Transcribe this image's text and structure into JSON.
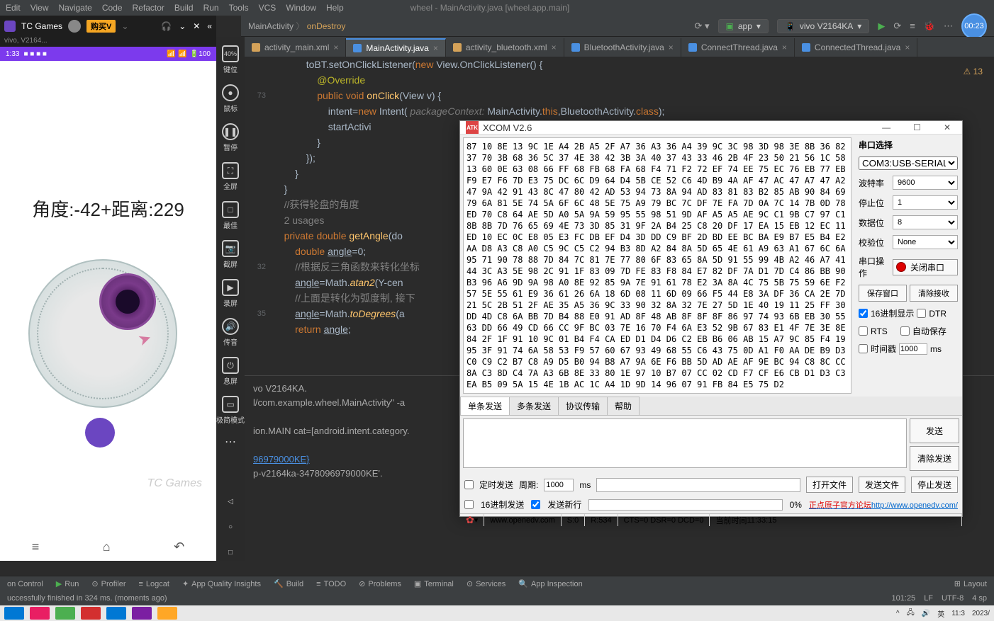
{
  "ide": {
    "menubar": [
      "Edit",
      "View",
      "Navigate",
      "Code",
      "Refactor",
      "Build",
      "Run",
      "Tools",
      "VCS",
      "Window",
      "Help"
    ],
    "title": "wheel - MainActivity.java [wheel.app.main]",
    "breadcrumb_class": "MainActivity",
    "breadcrumb_method": "onDestroy",
    "app_label": "app",
    "device_label": "vivo V2164KA",
    "timer": "00:23",
    "warnings": "13",
    "tabs": [
      {
        "name": "activity_main.xml",
        "type": "xml",
        "active": false
      },
      {
        "name": "MainActivity.java",
        "type": "java",
        "active": true
      },
      {
        "name": "activity_bluetooth.xml",
        "type": "xml",
        "active": false
      },
      {
        "name": "BluetoothActivity.java",
        "type": "java",
        "active": false
      },
      {
        "name": "ConnectThread.java",
        "type": "java",
        "active": false
      },
      {
        "name": "ConnectedThread.java",
        "type": "java",
        "active": false
      }
    ],
    "gutters": [
      "",
      "",
      "73",
      "",
      "",
      "",
      "",
      "",
      "",
      "",
      "",
      "",
      "",
      "",
      "32",
      "",
      "",
      "",
      "35",
      "",
      "",
      "",
      ""
    ],
    "usages": "2 usages",
    "code_text": {
      "l1a": "toBT",
      "l1b": ".setOnClickListener(",
      "l1c": "new",
      "l1d": " View.OnClickListener() {",
      "l2": "@Override",
      "l3a": "public void ",
      "l3b": "onClick",
      "l3c": "(View v) {",
      "l4a": "intent=",
      "l4b": "new ",
      "l4c": "Intent",
      "l4d": "( ",
      "l4e": "packageContext:",
      "l4f": " MainActivity.",
      "l4g": "this",
      ",l4h": ",BluetoothActivity.",
      "l4i": "class",
      "l4j": ");",
      "l5": "startActivi",
      "l6": "}",
      "l7": "});",
      "l8": "}",
      "l9": "}",
      "lc1": "//获得轮盘的角度",
      "l10a": "private double ",
      "l10b": "getAngle",
      "l10c": "(do",
      "l11a": "double ",
      "l11b": "angle",
      "l11c": "=0;",
      "lc2": "//根据反三角函数来转化坐标",
      "l12a": "angle",
      "l12b": "=Math.",
      "l12c": "atan2",
      "l12d": "(Y-cen",
      "lc3": "//上面是转化为弧度制, 接下",
      "l13a": "angle",
      "l13b": "=Math.",
      "l13c": "toDegrees",
      "l13d": "(a",
      "l14a": "return ",
      "l14b": "angle",
      "l14c": ";"
    },
    "console": {
      "l1": "vo V2164KA.",
      "l2": "l/com.example.wheel.MainActivity\" -a",
      "l3": "ion.MAIN cat=[android.intent.category.",
      "l4": "96979000KE}",
      "l5": "p-v2164ka-3478096979000KE'."
    },
    "bottombar": {
      "version": "on Control",
      "run": "Run",
      "profiler": "Profiler",
      "logcat": "Logcat",
      "quality": "App Quality Insights",
      "build": "Build",
      "todo": "TODO",
      "problems": "Problems",
      "terminal": "Terminal",
      "services": "Services",
      "inspection": "App Inspection",
      "layout": "Layout"
    },
    "status_msg": "uccessfully finished in 324 ms. (moments ago)",
    "status_right": {
      "pos": "101:25",
      "lf": "LF",
      "enc": "UTF-8",
      "sp": "4 sp"
    }
  },
  "tcgames": {
    "title": "TC Games",
    "subtitle": "vivo, V2164...",
    "buy": "购买",
    "phone_time": "1:33",
    "angle_text": "角度:-42+距离:229",
    "watermark": "TC Games",
    "tools": [
      {
        "icon": "40%",
        "label": "键位"
      },
      {
        "icon": "●",
        "label": "鼠标"
      },
      {
        "icon": "❚❚",
        "label": "暂停"
      },
      {
        "icon": "⛶",
        "label": "全屏"
      },
      {
        "icon": "□",
        "label": "最佳"
      },
      {
        "icon": "📷",
        "label": "截屏"
      },
      {
        "icon": "▶",
        "label": "录屏"
      },
      {
        "icon": "🔊",
        "label": "传音"
      },
      {
        "icon": "⏻",
        "label": "息屏"
      },
      {
        "icon": "▭",
        "label": "极简模式"
      }
    ]
  },
  "xcom": {
    "title": "XCOM V2.6",
    "hex": "87 10 8E 13 9C 1E A4 2B A5 2F A7 36 A3 36 A4 39 9C 3C 98 3D 98 3E 8B 36 82 37 70 3B 68 36 5C 37 4E 38 42 3B 3A 40 37 43 33 46 2B 4F 23 50 21 56 1C 58 13 60 0E 63 08 66 FF 68 FB 68 FA 68 F4 71 F2 72 EF 74 EE 75 EC 76 EB 77 EB F9 E7 F6 7D E3 75 DC 6C D9 64 D4 5B CE 52 C6 4D B9 4A AF 47 AC 47 A7 47 A2 47 9A 42 91 43 8C 47 80 42 AD 53 94 73 8A 94 AD 83 81 83 B2 85 AB 90 84 69 79 6A 81 5E 74 5A 6F 6C 48 5E 75 A9 79 BC 7C DF 7E FA 7D 0A 7C 14 7B 0D 78 ED 70 C8 64 AE 5D A0 5A 9A 59 95 55 98 51 9D AF A5 A5 AE 9C C1 9B C7 97 C1 8B 8B 7D 76 65 69 4E 73 3D 85 31 9F 2A B4 25 C8 20 DF 17 EA 15 EB 12 EC 11 ED 10 EC 0C E8 05 E3 FC DB EF D4 3D DD C9 BF 2D BD EE BC BA E9 B7 E5 B4 E2 AA D8 A3 C8 A0 C5 9C C5 C2 94 B3 8D A2 84 8A 5D 65 4E 61 A9 63 A1 67 6C 6A 95 71 90 78 88 7D 84 7C 81 7E 77 80 6F 83 65 8A 5D 91 55 99 4B A2 46 A7 41 44 3C A3 5E 98 2C 91 1F 83 09 7D FE 83 F8 84 E7 82 DF 7A D1 7D C4 86 BB 90 B3 96 A6 9D 9A 98 A0 8E 92 85 9A 7E 91 61 78 E2 3A 8A 4C 75 5B 75 59 6E F2 57 5E 55 61 E9 36 61 26 6A 18 6D 08 11 6D 09 66 F5 44 E8 3A DF 36 CA 2E 7D 21 5C 2B 51 2F AE 35 A5 36 9C 33 90 32 8A 32 7E 27 5D 1E 40 19 11 25 FF 30 DD 4D C8 6A BB 7D B4 88 E0 91 AD 8F 48 AB 8F 8F 8F 86 97 74 93 6B EB 30 55 63 DD 66 49 CD 66 CC 9F BC 03 7E 16 70 F4 6A E3 52 9B 67 83 E1 4F 7E 3E 8E 84 2F 1F 91 10 9C 01 B4 F4 CA ED D1 D4 D6 C2 EB B6 06 AB 15 A7 9C 85 F4 19 95 3F 91 74 6A 58 53 F9 57 60 67 93 49 68 55 C6 43 75 0D A1 F0 AA DE B9 D3 C0 C9 C2 B7 C8 A9 D5 B0 94 B8 A7 9A 6E F6 BB 5D AD AE AF 9E BC 94 C8 8C CC 8A C3 8D C4 7A A3 6B 8E 33 80 1E 97 10 B7 07 CC 02 CD F7 CF E6 CB D1 D3 C3 EA B5 09 5A 15 4E 1B AC 1C A4 1D 9D 14 96 07 91 FB 84 E5 75 D2",
    "sidebar": {
      "section": "串口选择",
      "com": "COM3:USB-SERIAL CH340",
      "baud_label": "波特率",
      "baud": "9600",
      "stop_label": "停止位",
      "stop": "1",
      "data_label": "数据位",
      "data": "8",
      "parity_label": "校验位",
      "parity": "None",
      "op_label": "串口操作",
      "close_port": "关闭串口",
      "save_win": "保存窗口",
      "clear_recv": "清除接收",
      "hex_disp": "16进制显示",
      "dtr": "DTR",
      "rts": "RTS",
      "autosave": "自动保存",
      "timestamp": "时间戳",
      "ts_val": "1000",
      "ts_unit": "ms"
    },
    "tabs": [
      "单条发送",
      "多条发送",
      "协议传输",
      "帮助"
    ],
    "send_btn": "发送",
    "clear_send": "清除发送",
    "timed_send": "定时发送",
    "period_label": "周期:",
    "period": "1000",
    "period_unit": "ms",
    "open_file": "打开文件",
    "send_file": "发送文件",
    "stop_send": "停止发送",
    "hex_send": "16进制发送",
    "send_newline": "发送新行",
    "progress": "0%",
    "forum_text": "正点原子官方论坛",
    "forum_url": "http://www.openedv.com/",
    "status": {
      "url": "www.openedv.com",
      "s": "S:0",
      "r": "R:534",
      "cts": "CTS=0 DSR=0 DCD=0",
      "time_label": "当前时间",
      "time": "11:33:15"
    }
  },
  "win": {
    "time": "11:3",
    "date": "2023/",
    "ime": "英"
  }
}
